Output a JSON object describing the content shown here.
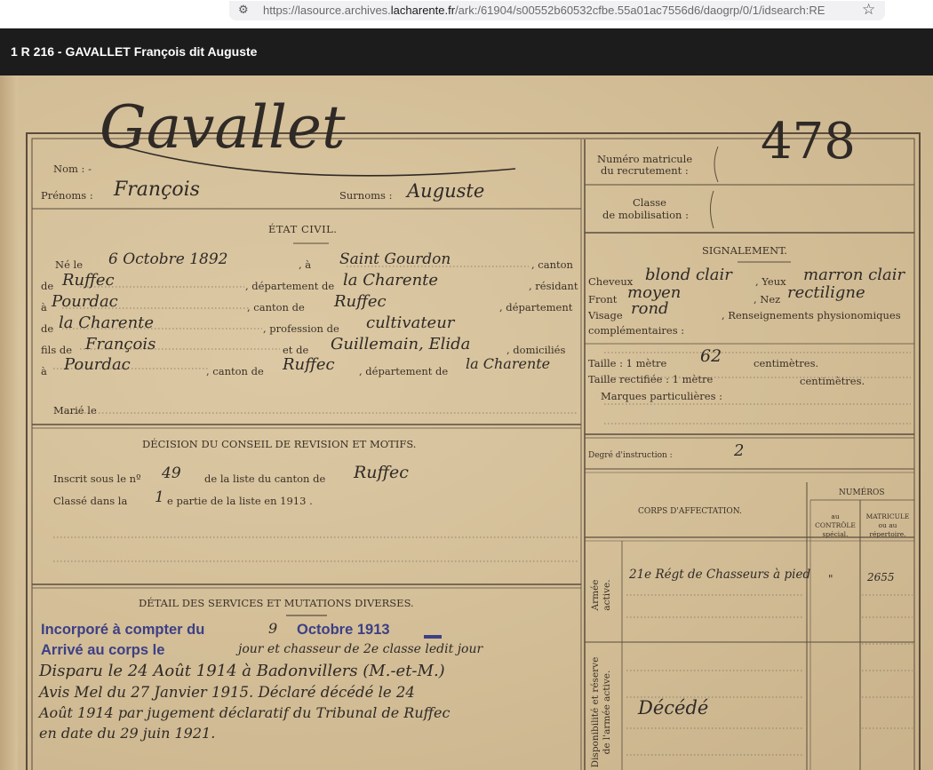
{
  "browser": {
    "url_prefix": "https://lasource.archives.",
    "url_domain": "lacharente.fr",
    "url_suffix": "/ark:/61904/s00552b60532cfbe.55a01ac7556d6/daogrp/0/1/idsearch:RE"
  },
  "viewer": {
    "title": "1 R 216 - GAVALLET François dit Auguste"
  },
  "form": {
    "printed": {
      "nom": "Nom : -",
      "prenoms": "Prénoms :",
      "surnoms": "Surnoms :",
      "etat_civil": "ÉTAT CIVIL.",
      "ne_le": "Né le",
      "a": ", à",
      "canton": ", canton",
      "de": "de",
      "departement_de": ", département de",
      "resident": ", résidant",
      "a2": "à",
      "canton_de": ", canton de",
      "departement": ", département",
      "de2": "de",
      "profession_de": ", profession de",
      "fils_de": "fils de",
      "et_de": "et de",
      "domicilies": ", domiciliés",
      "a3": "à",
      "canton_de2": ", canton de",
      "departement_de2": ", département de",
      "marie_le": "Marié le",
      "decision": "DÉCISION DU CONSEIL DE REVISION ET MOTIFS.",
      "inscrit": "Inscrit sous le nº",
      "de_la_liste": "de la liste du canton de",
      "classe_dans": "Classé dans la",
      "partie": "e partie de la liste en 1913 .",
      "detail": "DÉTAIL DES SERVICES ET MUTATIONS DIVERSES.",
      "numero_matricule_1": "Numéro matricule",
      "numero_matricule_2": "du recrutement :",
      "classe_1": "Classe",
      "classe_2": "de mobilisation :",
      "signalement": "SIGNALEMENT.",
      "cheveux": "Cheveux",
      "yeux": ", Yeux",
      "front": "Front",
      "nez": ", Nez",
      "visage": "Visage",
      "renseignements": ", Renseignements physionomiques",
      "complementaires": "complémentaires :",
      "taille": "Taille : 1 mètre",
      "centimetres": "centimètres.",
      "taille_rectifiee": "Taille rectifiée : 1 mètre",
      "centimetres2": "centimètres.",
      "marques": "Marques particulières :",
      "degre": "Degré d'instruction :",
      "numeros": "NUMÉROS",
      "corps": "CORPS D'AFFECTATION.",
      "au_controle": "au\nCONTRÔLE\nspécial.",
      "matricule": "MATRICULE\nou au\nrépertoire.",
      "armee_active": "Armée\nactive.",
      "disponibilite": "Disponibilité et réserve\nde l'armée active."
    },
    "handwritten": {
      "surname": "Gavallet",
      "first_name": "François",
      "surnom": "Auguste",
      "matricule": "478",
      "birth_date": "6 Octobre 1892",
      "birth_place": "Saint Gourdon",
      "birth_canton": "Ruffec",
      "birth_department": "la Charente",
      "residence": "Pourdac",
      "residence_canton": "Ruffec",
      "residence_department": "la Charente",
      "profession": "cultivateur",
      "father": "François",
      "mother": "Guillemain, Elida",
      "domicile": "Pourdac",
      "domicile_canton": "Ruffec",
      "domicile_department": "la Charente",
      "hair": "blond clair",
      "eyes": "marron clair",
      "forehead": "moyen",
      "nose": "rectiligne",
      "face": "rond",
      "height_cm": "62",
      "instruction": "2",
      "list_number": "49",
      "list_canton": "Ruffec",
      "list_part": "1",
      "corps": "21e Régt de Chasseurs à pied",
      "controle": "\"",
      "matricule_no": "2655",
      "reserve_status": "Décédé",
      "arrive_rest": "jour et chasseur de 2e classe ledit jour",
      "line3": "Disparu le 24 Août 1914 à Badonvillers (M.-et-M.)",
      "line4": "Avis Mel du 27 Janvier 1915. Déclaré décédé le 24",
      "line5": "Août 1914 par jugement déclaratif du Tribunal de Ruffec",
      "line6": "en date du 29 juin 1921."
    },
    "stamps": {
      "incorpore": "Incorporé à compter du",
      "incorpore_day": "9",
      "incorpore_month": "Octobre 1913",
      "arrive": "Arrivé au corps le"
    }
  }
}
